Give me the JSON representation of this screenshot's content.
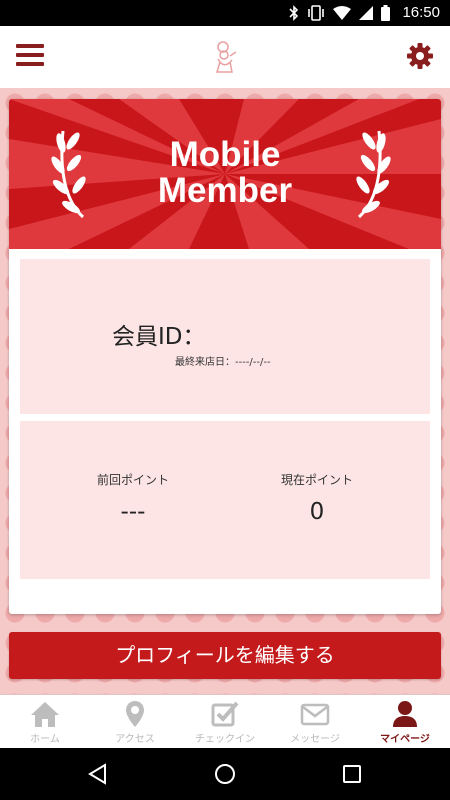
{
  "status_bar": {
    "time": "16:50",
    "icons": [
      "bluetooth-icon",
      "vibrate-icon",
      "wifi-icon",
      "signal-icon",
      "battery-icon"
    ]
  },
  "header": {
    "menu_icon": "hamburger-menu-icon",
    "logo_icon": "chef-logo-icon",
    "settings_icon": "gear-icon"
  },
  "banner": {
    "title_line1": "Mobile",
    "title_line2": "Member"
  },
  "member": {
    "id_label": "会員ID：",
    "id_value": "",
    "last_visit": "最終来店日：----/--/--"
  },
  "points": {
    "previous_label": "前回ポイント",
    "previous_value": "---",
    "current_label": "現在ポイント",
    "current_value": "0"
  },
  "edit_profile_label": "プロフィールを編集する",
  "bottom_nav": {
    "items": [
      {
        "label": "ホーム",
        "icon": "home-icon"
      },
      {
        "label": "アクセス",
        "icon": "map-pin-icon"
      },
      {
        "label": "チェックイン",
        "icon": "checkbox-icon"
      },
      {
        "label": "メッセージ",
        "icon": "envelope-icon"
      },
      {
        "label": "マイページ",
        "icon": "person-icon",
        "active": true
      }
    ]
  },
  "colors": {
    "brand_red": "#c41a1c",
    "dark_red": "#8a1d1d",
    "panel_pink": "#fde5e5",
    "inactive_gray": "#b8b8b8"
  }
}
